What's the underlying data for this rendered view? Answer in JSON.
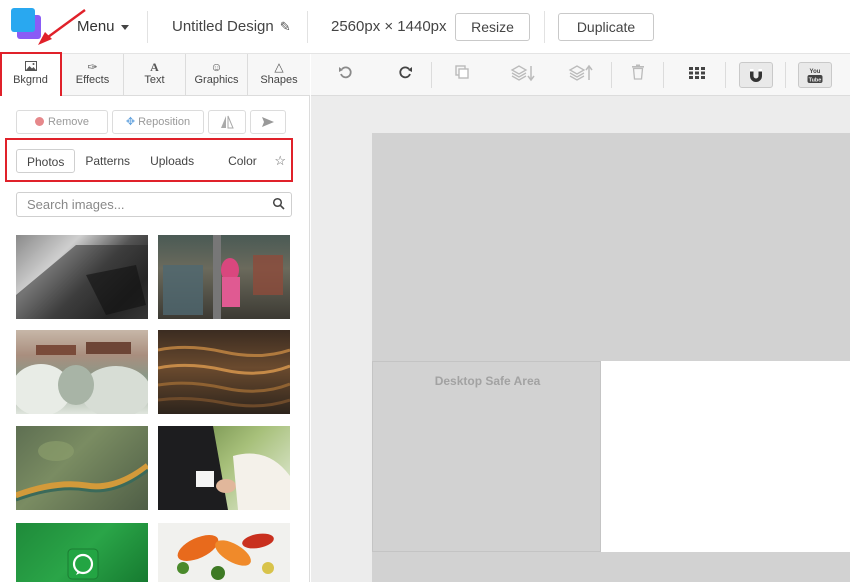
{
  "header": {
    "menu_label": "Menu",
    "design_title": "Untitled Design",
    "dimensions": "2560px × 1440px",
    "resize_label": "Resize",
    "duplicate_label": "Duplicate"
  },
  "tool_tabs": [
    {
      "label": "Bkgrnd",
      "icon": "image-icon",
      "active": true
    },
    {
      "label": "Effects",
      "icon": "magic-wand-icon"
    },
    {
      "label": "Text",
      "icon": "text-icon"
    },
    {
      "label": "Graphics",
      "icon": "smiley-icon"
    },
    {
      "label": "Shapes",
      "icon": "triangle-icon"
    }
  ],
  "panel": {
    "remove_label": "Remove",
    "reposition_label": "Reposition",
    "subtabs": [
      "Photos",
      "Patterns",
      "Uploads",
      "Color"
    ],
    "active_subtab": "Photos",
    "search_placeholder": "Search images..."
  },
  "toolbar": {
    "icons": [
      "undo-icon",
      "redo-icon",
      "copy-icon",
      "layer-down-icon",
      "layer-up-icon",
      "trash-icon",
      "grid-icon",
      "magnet-icon",
      "youtube-icon"
    ]
  },
  "canvas": {
    "safe_area_label": "Desktop Safe Area"
  },
  "colors": {
    "annotation_red": "#e0212a",
    "logo_blue": "#29a8f0",
    "logo_purple": "#8a5cf6"
  }
}
